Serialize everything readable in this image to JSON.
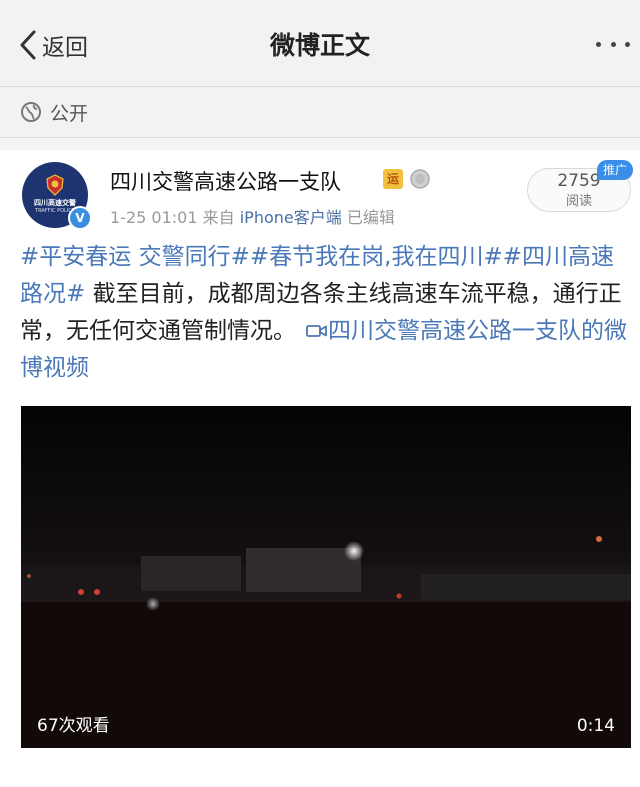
{
  "nav": {
    "back_label": "返回",
    "title": "微博正文"
  },
  "visibility": {
    "label": "公开"
  },
  "post": {
    "author": "四川交警高速公路一支队",
    "avatar_text_top": "四川高速交警",
    "avatar_text_bottom": "TRAFFIC POLICE",
    "verified_mark": "V",
    "badge_label": "运",
    "timestamp": "1-25 01:01",
    "source_prefix": "来自",
    "source": "iPhone客户端",
    "edited": "已编辑",
    "reads_count": "2759",
    "reads_label": "阅读",
    "promo_label": "推广",
    "tag1": "#平安春运 交警同行#",
    "tag2": "#春节我在岗,我在四川#",
    "tag3": "#四川高速路况#",
    "body": " 截至目前，成都周边各条主线高速车流平稳，通行正常，无任何交通管制情况。",
    "video_link": "四川交警高速公路一支队的微博视频"
  },
  "video": {
    "views": "67次观看",
    "duration": "0:14"
  },
  "colors": {
    "link": "#4a78b8",
    "avatar_bg": "#1e3470",
    "promo": "#3b8ee8"
  }
}
